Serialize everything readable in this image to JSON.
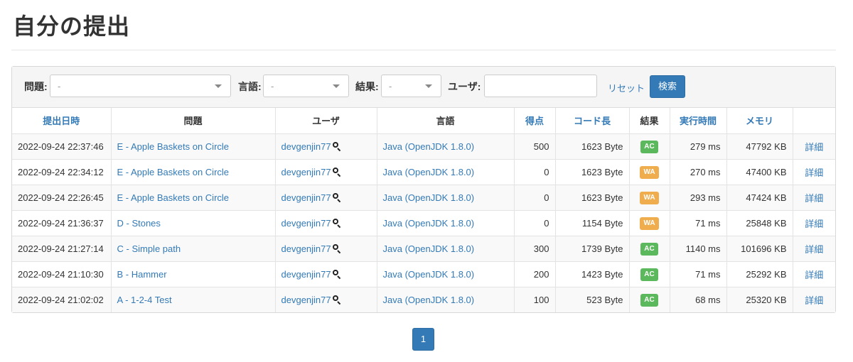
{
  "title": "自分の提出",
  "filters": {
    "problem_label": "問題:",
    "problem_value": "-",
    "language_label": "言語:",
    "language_value": "-",
    "result_label": "結果:",
    "result_value": "-",
    "user_label": "ユーザ:",
    "user_value": "",
    "reset_label": "リセット",
    "search_label": "検索"
  },
  "columns": [
    "提出日時",
    "問題",
    "ユーザ",
    "言語",
    "得点",
    "コード長",
    "結果",
    "実行時間",
    "メモリ",
    ""
  ],
  "rows": [
    {
      "date": "2022-09-24 22:37:46",
      "problem": "E - Apple Baskets on Circle",
      "user": "devgenjin77",
      "language": "Java (OpenJDK 1.8.0)",
      "score": "500",
      "code_length": "1623 Byte",
      "result": "AC",
      "time": "279 ms",
      "memory": "47792 KB",
      "detail": "詳細"
    },
    {
      "date": "2022-09-24 22:34:12",
      "problem": "E - Apple Baskets on Circle",
      "user": "devgenjin77",
      "language": "Java (OpenJDK 1.8.0)",
      "score": "0",
      "code_length": "1623 Byte",
      "result": "WA",
      "time": "270 ms",
      "memory": "47400 KB",
      "detail": "詳細"
    },
    {
      "date": "2022-09-24 22:26:45",
      "problem": "E - Apple Baskets on Circle",
      "user": "devgenjin77",
      "language": "Java (OpenJDK 1.8.0)",
      "score": "0",
      "code_length": "1623 Byte",
      "result": "WA",
      "time": "293 ms",
      "memory": "47424 KB",
      "detail": "詳細"
    },
    {
      "date": "2022-09-24 21:36:37",
      "problem": "D - Stones",
      "user": "devgenjin77",
      "language": "Java (OpenJDK 1.8.0)",
      "score": "0",
      "code_length": "1154 Byte",
      "result": "WA",
      "time": "71 ms",
      "memory": "25848 KB",
      "detail": "詳細"
    },
    {
      "date": "2022-09-24 21:27:14",
      "problem": "C - Simple path",
      "user": "devgenjin77",
      "language": "Java (OpenJDK 1.8.0)",
      "score": "300",
      "code_length": "1739 Byte",
      "result": "AC",
      "time": "1140 ms",
      "memory": "101696 KB",
      "detail": "詳細"
    },
    {
      "date": "2022-09-24 21:10:30",
      "problem": "B - Hammer",
      "user": "devgenjin77",
      "language": "Java (OpenJDK 1.8.0)",
      "score": "200",
      "code_length": "1423 Byte",
      "result": "AC",
      "time": "71 ms",
      "memory": "25292 KB",
      "detail": "詳細"
    },
    {
      "date": "2022-09-24 21:02:02",
      "problem": "A - 1-2-4 Test",
      "user": "devgenjin77",
      "language": "Java (OpenJDK 1.8.0)",
      "score": "100",
      "code_length": "523 Byte",
      "result": "AC",
      "time": "68 ms",
      "memory": "25320 KB",
      "detail": "詳細"
    }
  ],
  "pagination": {
    "current": "1"
  },
  "colors": {
    "accent": "#337ab7",
    "ac": "#5cb85c",
    "wa": "#f0ad4e"
  }
}
